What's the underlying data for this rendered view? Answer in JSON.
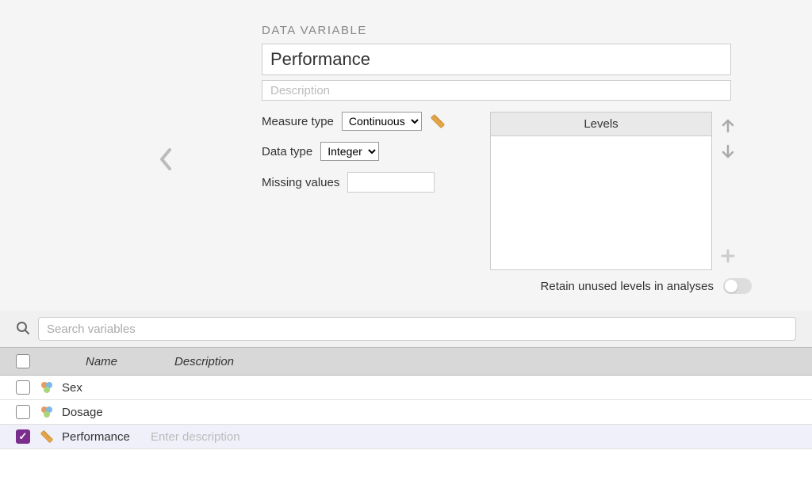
{
  "header": {
    "title": "DATA VARIABLE"
  },
  "variable": {
    "name": "Performance",
    "description": "",
    "description_placeholder": "Description"
  },
  "measure_type": {
    "label": "Measure type",
    "value": "Continuous"
  },
  "data_type": {
    "label": "Data type",
    "value": "Integer"
  },
  "missing_values": {
    "label": "Missing values",
    "value": ""
  },
  "levels": {
    "header": "Levels",
    "retain_label": "Retain unused levels in analyses",
    "retain_value": false
  },
  "search": {
    "placeholder": "Search variables"
  },
  "list": {
    "col_name": "Name",
    "col_desc": "Description",
    "desc_placeholder": "Enter description",
    "items": [
      {
        "name": "Sex",
        "icon": "nominal",
        "checked": false,
        "desc": ""
      },
      {
        "name": "Dosage",
        "icon": "nominal",
        "checked": false,
        "desc": ""
      },
      {
        "name": "Performance",
        "icon": "continuous",
        "checked": true,
        "desc": ""
      }
    ]
  }
}
